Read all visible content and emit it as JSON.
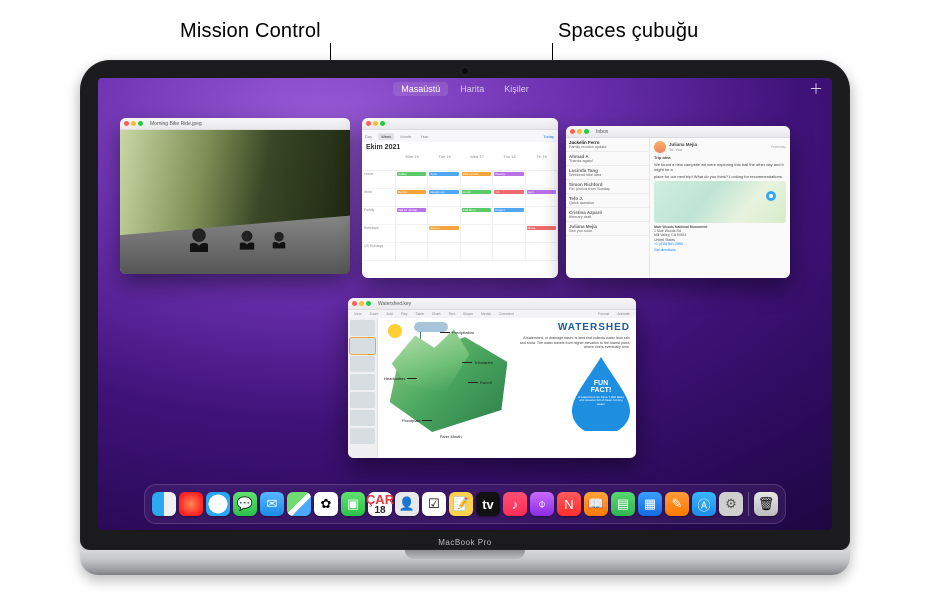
{
  "callouts": {
    "mission_control": "Mission Control",
    "spaces_bar": "Spaces çubuğu"
  },
  "device": {
    "model": "MacBook Pro"
  },
  "spaces": {
    "add_glyph": "＋",
    "items": [
      {
        "label": "Masaüstü",
        "active": true
      },
      {
        "label": "Harita",
        "active": false
      },
      {
        "label": "Kişiler",
        "active": false
      }
    ]
  },
  "windows": {
    "photo_viewer": {
      "title": "Morning Bike Ride.jpeg"
    },
    "calendar": {
      "month": "Ekim 2021",
      "view_tabs": [
        "Day",
        "Week",
        "Month",
        "Year"
      ],
      "selected_tab": "Week",
      "today_label": "Today",
      "day_headers": [
        "Mon 15",
        "Tue 16",
        "Wed 17",
        "Thu 18",
        "Fri 19"
      ],
      "sidebar_calendars": [
        "Home",
        "Work",
        "Family",
        "Birthdays",
        "US Holidays"
      ],
      "events": {
        "r0": [
          "Coffee",
          "Sync",
          "Pick up kids",
          "Weekly",
          ""
        ],
        "r1": [
          "Dentist",
          "Design rev",
          "Lunch",
          "1:1",
          "Gym"
        ],
        "r2": [
          "Talk w/ Jordan",
          "",
          "Call Mom",
          "Project",
          ""
        ],
        "r3": [
          "",
          "Soccer",
          "",
          "",
          "Movie"
        ]
      }
    },
    "mail": {
      "title": "Inbox",
      "messages": [
        {
          "from": "Jackelin Ferro",
          "subject": "Family reunion update",
          "unread": true
        },
        {
          "from": "Ahmad A",
          "subject": "Thanks again!",
          "unread": false
        },
        {
          "from": "Lucinda Tang",
          "subject": "Weekend hike idea",
          "unread": false
        },
        {
          "from": "Simon Richford",
          "subject": "Re: photos from Sunday",
          "unread": false
        },
        {
          "from": "Tefo J.",
          "subject": "Quick question",
          "unread": false
        },
        {
          "from": "Cristina Azparó",
          "subject": "Itinerary draft",
          "unread": false
        },
        {
          "from": "Juliana Mejía",
          "subject": "See you soon",
          "unread": false
        }
      ],
      "open": {
        "from": "Juliana Mejía",
        "to_line": "To: You",
        "subject": "Trip idea",
        "date": "Yesterday",
        "body_1": "We found a new campsite we were exploring this trail the other day and it might be a",
        "body_2": "place for our next trip! What do you think? Looking for recommendations.",
        "place_name": "Muir Woods National Monument",
        "addr_1": "1 Muir Woods Rd",
        "addr_2": "Mill Valley, CA 94941",
        "addr_3": "United States",
        "phone": "+1 (415) 561-2850",
        "link": "Get directions"
      }
    },
    "keynote": {
      "menus": [
        "View",
        "Zoom",
        "Add",
        "Play",
        "Table",
        "Chart",
        "Text",
        "Shape",
        "Media",
        "Comment",
        "Format",
        "Animate"
      ],
      "doc": "Watershed.key",
      "heading": "WATERSHED",
      "para": "A watershed, or drainage basin, is land that collects water from rain and snow. The water travels from higher elevation to the lowest point, where rivers eventually form.",
      "drop_big": "FUN",
      "drop_big2": "FACT!",
      "drop_small": "A watershed can have 7,000 lakes and streams full of clean running water!",
      "labels": {
        "precip": "Precipitation",
        "trib": "Tributaries",
        "runoff": "Runoff",
        "headwaters": "Headwaters",
        "floodplain": "Floodplain",
        "mouth": "River Mouth"
      }
    }
  },
  "dock": {
    "cal_day_top": "ÇAR",
    "cal_day_num": "18",
    "tv": "tv",
    "items": [
      "finder",
      "launchpad",
      "safari",
      "messages",
      "mail",
      "maps",
      "photos",
      "facetime",
      "calendar",
      "contacts",
      "reminders",
      "notes",
      "tv",
      "music",
      "podcasts",
      "news",
      "books",
      "numbers",
      "keynote",
      "pages",
      "app-store",
      "system-preferences"
    ]
  }
}
